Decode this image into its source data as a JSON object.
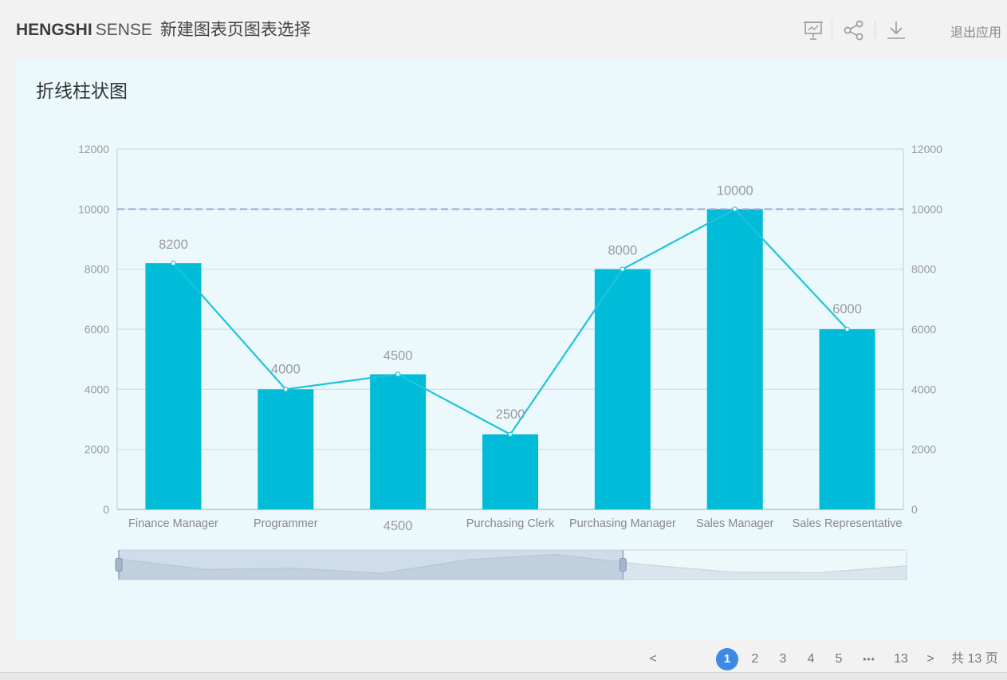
{
  "header": {
    "brand_bold": "HENGSHI",
    "brand_light": "SENSE",
    "page_title": "新建图表页图表选择",
    "exit_label": "退出应用",
    "icons": [
      "present-icon",
      "share-icon",
      "download-icon"
    ]
  },
  "card": {
    "title": "折线柱状图"
  },
  "chart_data": {
    "type": "bar+line",
    "categories": [
      "Finance Manager",
      "Programmer",
      "4500",
      "Purchasing Clerk",
      "Purchasing Manager",
      "Sales Manager",
      "Sales Representative"
    ],
    "bar_values": [
      8200,
      4000,
      4500,
      2500,
      8000,
      10000,
      6000
    ],
    "line_values": [
      8200,
      4000,
      4500,
      2500,
      8000,
      10000,
      6000
    ],
    "data_labels": [
      "8200",
      "4000",
      "4500",
      "2500",
      "8000",
      "10000",
      "6000"
    ],
    "y_left": {
      "min": 0,
      "max": 12000,
      "ticks": [
        "0",
        "2000",
        "4000",
        "6000",
        "8000",
        "10000",
        "12000"
      ]
    },
    "y_right": {
      "min": 0,
      "max": 12000,
      "ticks": [
        "0",
        "2000",
        "4000",
        "6000",
        "8000",
        "10000",
        "12000"
      ]
    },
    "reference_line": 10000,
    "grid": true,
    "colors": {
      "bar": "#00bcd8",
      "line": "#1ec4d9",
      "reference": "#a9a8d9",
      "grid": "#c9dfe3"
    },
    "zoom_range": [
      0,
      0.64
    ],
    "zoom_preview": [
      8200,
      4000,
      4500,
      2500,
      8000,
      10000,
      6000,
      3000,
      2800,
      5500
    ]
  },
  "pager": {
    "prev": "<",
    "pages": [
      "1",
      "2",
      "3",
      "4",
      "5"
    ],
    "ellipsis": "•••",
    "last": "13",
    "next": ">",
    "total": "共 13 页",
    "current": 1
  }
}
